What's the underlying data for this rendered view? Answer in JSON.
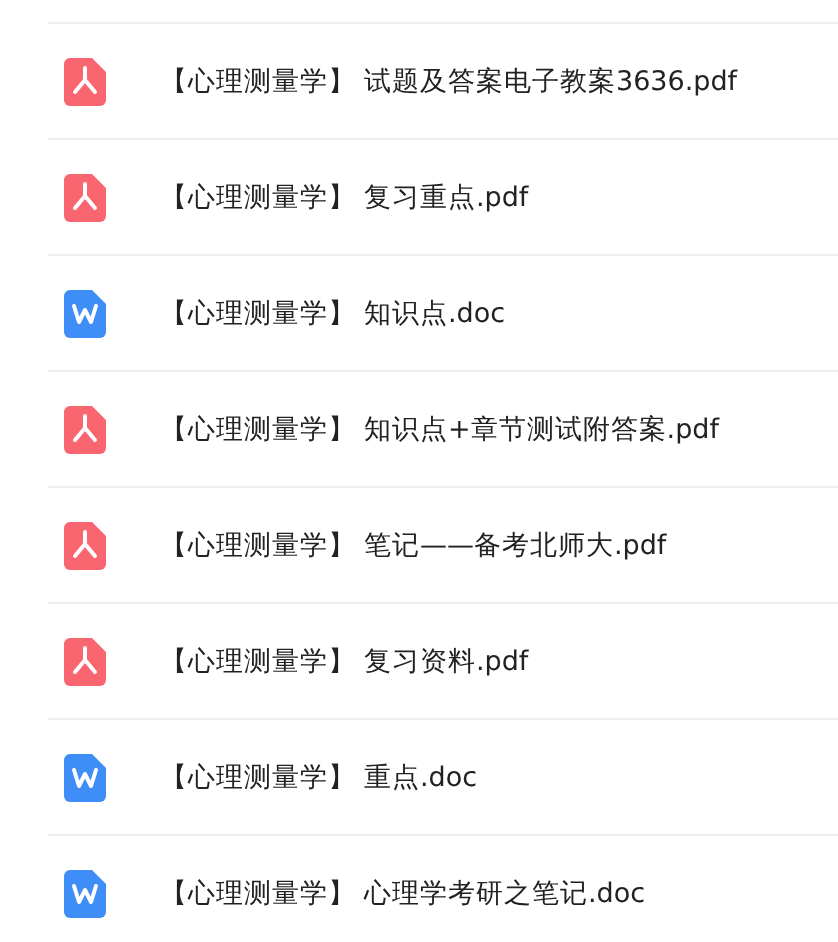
{
  "files": [
    {
      "kind": "pdf",
      "prefix": "【心理测量学】",
      "name": "试题及答案电子教案3636.pdf"
    },
    {
      "kind": "pdf",
      "prefix": "【心理测量学】",
      "name": "复习重点.pdf"
    },
    {
      "kind": "doc",
      "prefix": "【心理测量学】",
      "name": "知识点.doc"
    },
    {
      "kind": "pdf",
      "prefix": "【心理测量学】",
      "name": "知识点+章节测试附答案.pdf"
    },
    {
      "kind": "pdf",
      "prefix": "【心理测量学】",
      "name": "笔记——备考北师大.pdf"
    },
    {
      "kind": "pdf",
      "prefix": "【心理测量学】",
      "name": "复习资料.pdf"
    },
    {
      "kind": "doc",
      "prefix": "【心理测量学】",
      "name": "重点.doc"
    },
    {
      "kind": "doc",
      "prefix": "【心理测量学】",
      "name": "心理学考研之笔记.doc"
    }
  ]
}
